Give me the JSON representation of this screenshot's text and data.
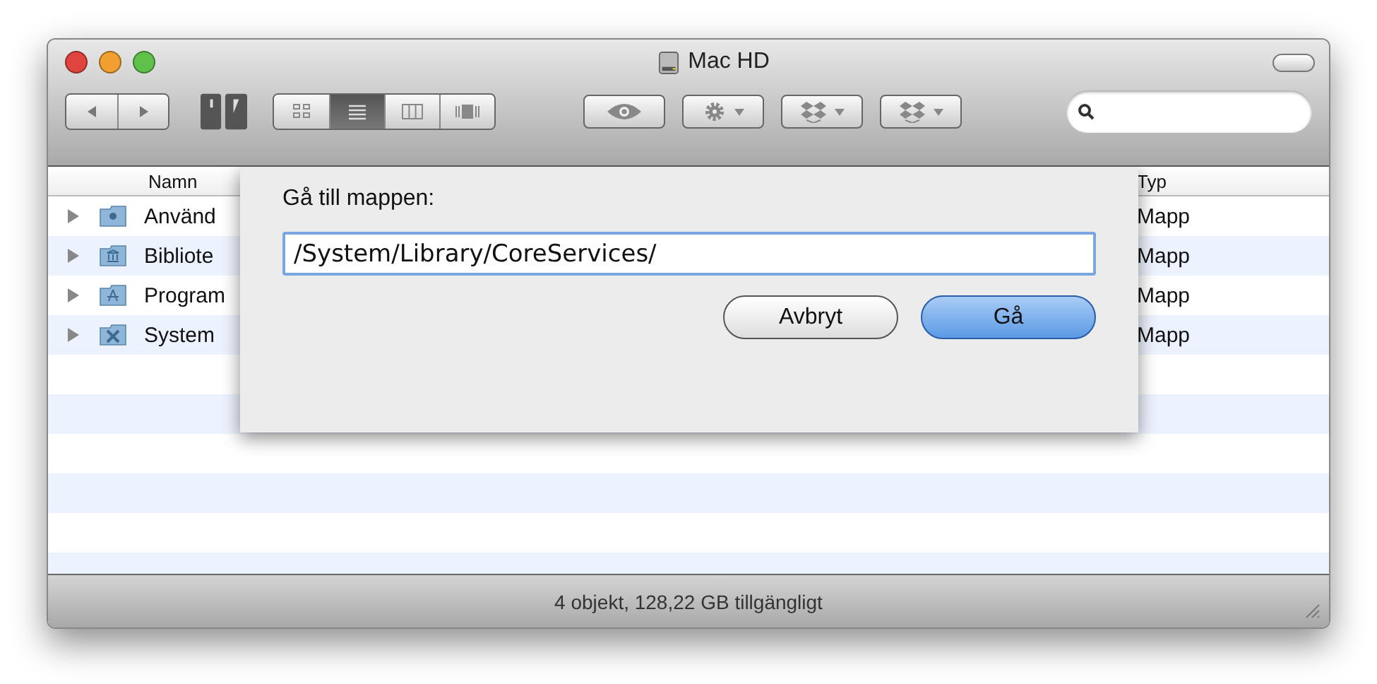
{
  "window": {
    "title": "Mac HD"
  },
  "toolbar": {
    "view_modes": [
      {
        "kind": "icon",
        "selected": false
      },
      {
        "kind": "list",
        "selected": true
      },
      {
        "kind": "columns",
        "selected": false
      },
      {
        "kind": "coverflow",
        "selected": false
      }
    ]
  },
  "table": {
    "columns": [
      "Namn",
      "Typ"
    ],
    "rows": [
      {
        "name": "Använd",
        "kind": "users",
        "type": "Mapp"
      },
      {
        "name": "Bibliote",
        "kind": "library",
        "type": "Mapp"
      },
      {
        "name": "Program",
        "kind": "apps",
        "type": "Mapp"
      },
      {
        "name": "System",
        "kind": "system",
        "type": "Mapp"
      }
    ]
  },
  "sheet": {
    "label": "Gå till mappen:",
    "value": "/System/Library/CoreServices/",
    "buttons": [
      {
        "label": "Avbryt",
        "kind": "cancel"
      },
      {
        "label": "Gå",
        "kind": "default"
      }
    ]
  },
  "status_bar": "4 objekt, 128,22 GB tillgängligt"
}
